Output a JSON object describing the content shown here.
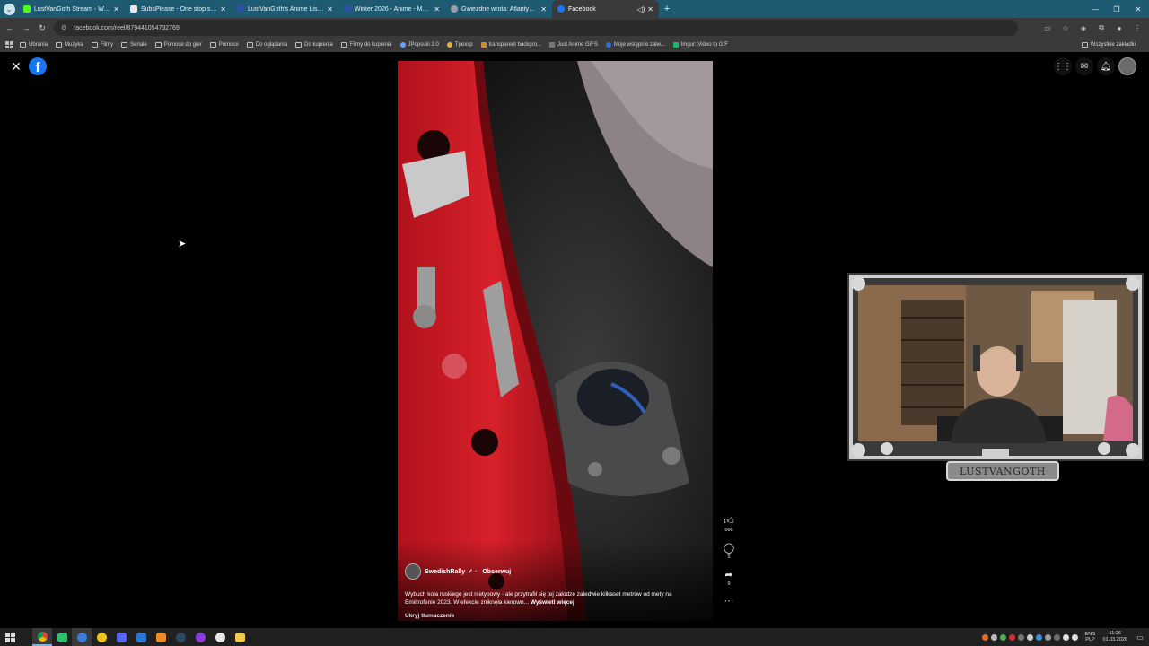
{
  "browser": {
    "tabs": [
      {
        "label": "LustVanGoth Stream - Watch L",
        "color": "#53fc18"
      },
      {
        "label": "SubsPlease - One stop shop fo",
        "color": "#e8e8e8"
      },
      {
        "label": "LustVanGoth's Anime List - My",
        "color": "#2e51a2"
      },
      {
        "label": "Winter 2026 - Anime - MyAnim",
        "color": "#2e51a2"
      },
      {
        "label": "Gwiezdne wrota: Atlantyda / St",
        "color": "#9aa0a6"
      },
      {
        "label": "Facebook",
        "color": "#1877f2",
        "active": true
      }
    ],
    "url": "facebook.com/reel/879441054732769",
    "bookmarks": [
      "Ubrania",
      "Muzyka",
      "Filmy",
      "Seriale",
      "Pomoce do gier",
      "Pomoce",
      "Do oglądania",
      "Do kupienia",
      "Filmy do kupienia",
      "JPopsuki 2.0",
      "Tpexxp",
      "transparent backgro...",
      "Just Anime GIFS",
      "Moje wstępnie załw...",
      "Imgur: Video to GIF"
    ],
    "all_bookmarks": "Wszystkie zakładki"
  },
  "facebook": {
    "author": "SwedishRally",
    "verified": "✓",
    "follow": "Obserwuj",
    "caption": "Wybuch koła ruskiego jest nietypowy - ale przytrafił się tej załodze zaledwie kilkaset metrów od mety na Emiltrofenie 2023. W efekcie zniknęła kierown...",
    "see_more": "Wyświetl więcej",
    "hide_translation": "Ukryj tłumaczenie",
    "likes": "666",
    "comments": "5",
    "shares": "9"
  },
  "stream": {
    "name_plate": "LUSTVANGOTH"
  },
  "taskbar": {
    "lang_top": "ENG",
    "lang_bottom": "PLP",
    "time": "11:26",
    "date": "01.03.2026"
  }
}
